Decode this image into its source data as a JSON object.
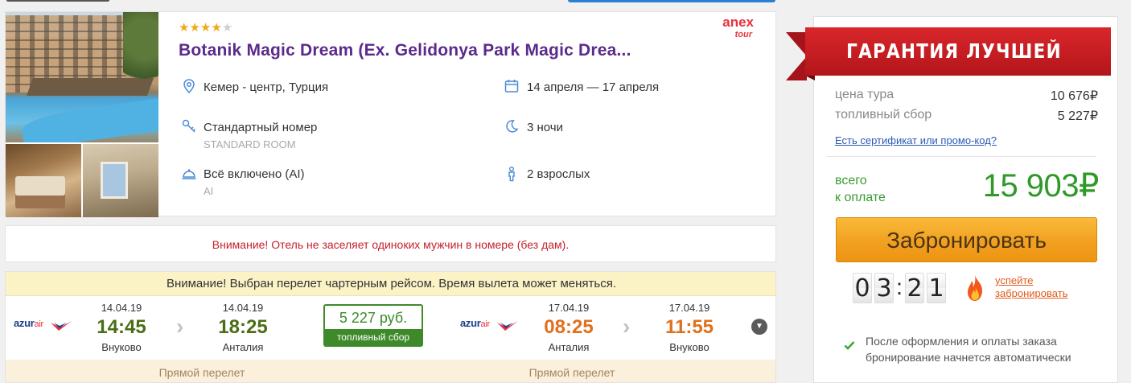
{
  "hotel": {
    "stars": 4,
    "stars_max": 5,
    "name": "Botanik Magic Dream (Ex. Gelidonya Park Magic Drea...",
    "operator_logo": {
      "brand": "anex",
      "sub": "tour"
    },
    "location": "Кемер - центр, Турция",
    "dates": "14 апреля — 17 апреля",
    "room": "Стандартный номер",
    "room_sub": "STANDARD ROOM",
    "nights": "3 ночи",
    "meal": "Всё включено (AI)",
    "meal_sub": "AI",
    "guests": "2 взрослых",
    "icons": [
      "location-pin-icon",
      "calendar-icon",
      "room-key-icon",
      "moon-icon",
      "meal-cloche-icon",
      "person-icon"
    ]
  },
  "notice": "Внимание! Отель не заселяет одиноких мужчин в номере (без дам).",
  "flight": {
    "banner": "Внимание! Выбран перелет чартерным рейсом. Время вылета может меняться.",
    "airline": {
      "name": "azur",
      "suffix": "air"
    },
    "outbound": {
      "dep_date": "14.04.19",
      "dep_time": "14:45",
      "dep_city": "Внуково",
      "arr_date": "14.04.19",
      "arr_time": "18:25",
      "arr_city": "Анталия",
      "type": "Прямой перелет"
    },
    "inbound": {
      "dep_date": "17.04.19",
      "dep_time": "08:25",
      "dep_city": "Анталия",
      "arr_date": "17.04.19",
      "arr_time": "11:55",
      "arr_city": "Внуково",
      "type": "Прямой перелет"
    },
    "fuel": {
      "price": "5 227 руб.",
      "label": "топливный сбор"
    }
  },
  "pricing": {
    "ribbon": "ГАРАНТИЯ ЛУЧШЕЙ ЦЕНЫ",
    "tour_price_label": "цена тура",
    "tour_price": "10 676₽",
    "fuel_label": "топливный сбор",
    "fuel_price": "5 227₽",
    "promo_link": "Есть сертификат или промо-код?",
    "total_label_1": "всего",
    "total_label_2": "к оплате",
    "total": "15 903₽",
    "book_button": "Забронировать",
    "timer": {
      "d1": "0",
      "d2": "3",
      "d3": "2",
      "d4": "1"
    },
    "hurry_line1": "успейте",
    "hurry_line2": "забронировать",
    "note": "После оформления и оплаты заказа бронирование начнется автоматически"
  },
  "colors": {
    "hotel_name": "#5b2a8c",
    "warning_text": "#c6202e",
    "total_green": "#2f9a28",
    "book_orange": "#f2a020",
    "ribbon_red": "#c41d22",
    "outbound_time": "#4a6e15",
    "inbound_time": "#e0701e"
  }
}
